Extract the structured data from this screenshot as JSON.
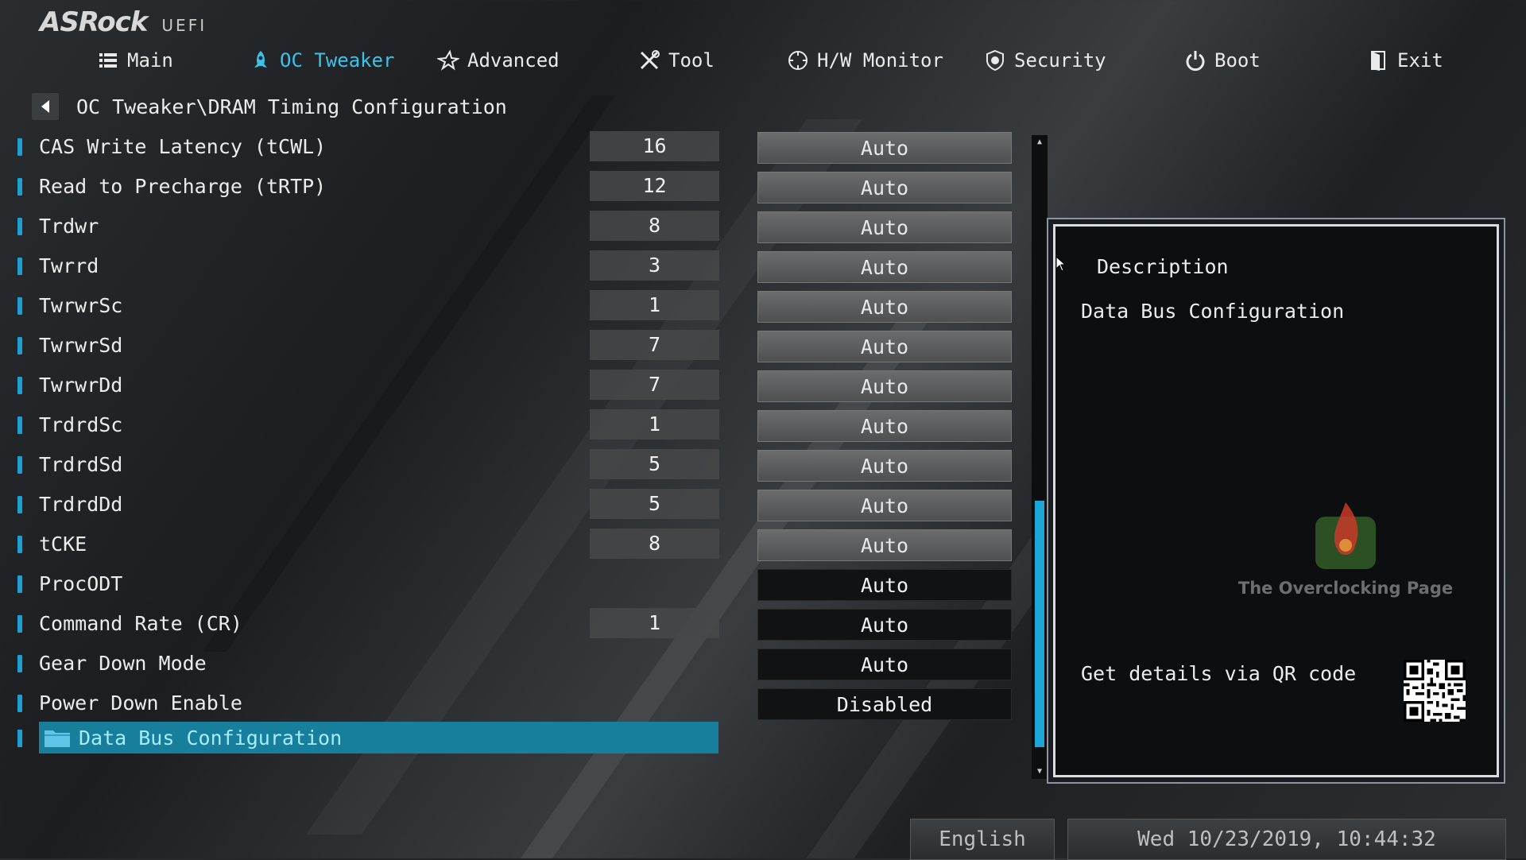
{
  "app": {
    "brand": "ASRock",
    "subtitle": "UEFI"
  },
  "tabs": [
    {
      "label": "Main",
      "icon": "list-icon"
    },
    {
      "label": "OC Tweaker",
      "icon": "rocket-icon",
      "active": true
    },
    {
      "label": "Advanced",
      "icon": "star-icon"
    },
    {
      "label": "Tool",
      "icon": "tools-icon"
    },
    {
      "label": "H/W Monitor",
      "icon": "monitor-icon"
    },
    {
      "label": "Security",
      "icon": "shield-icon"
    },
    {
      "label": "Boot",
      "icon": "power-icon"
    },
    {
      "label": "Exit",
      "icon": "exit-door-icon"
    }
  ],
  "breadcrumb": {
    "path": "OC Tweaker\\DRAM Timing Configuration"
  },
  "settings": [
    {
      "label": "CAS Write Latency (tCWL)",
      "value": "16",
      "option": "Auto",
      "style": "light"
    },
    {
      "label": "Read to Precharge (tRTP)",
      "value": "12",
      "option": "Auto",
      "style": "light"
    },
    {
      "label": "Trdwr",
      "value": "8",
      "option": "Auto",
      "style": "light"
    },
    {
      "label": "Twrrd",
      "value": "3",
      "option": "Auto",
      "style": "light"
    },
    {
      "label": "TwrwrSc",
      "value": "1",
      "option": "Auto",
      "style": "light"
    },
    {
      "label": "TwrwrSd",
      "value": "7",
      "option": "Auto",
      "style": "light"
    },
    {
      "label": "TwrwrDd",
      "value": "7",
      "option": "Auto",
      "style": "light"
    },
    {
      "label": "TrdrdSc",
      "value": "1",
      "option": "Auto",
      "style": "light"
    },
    {
      "label": "TrdrdSd",
      "value": "5",
      "option": "Auto",
      "style": "light"
    },
    {
      "label": "TrdrdDd",
      "value": "5",
      "option": "Auto",
      "style": "light"
    },
    {
      "label": "tCKE",
      "value": "8",
      "option": "Auto",
      "style": "light"
    },
    {
      "label": "ProcODT",
      "value": "",
      "option": "Auto",
      "style": "dark"
    },
    {
      "label": "Command Rate (CR)",
      "value": "1",
      "option": "Auto",
      "style": "dark"
    },
    {
      "label": "Gear Down Mode",
      "value": "",
      "option": "Auto",
      "style": "dark"
    },
    {
      "label": "Power Down Enable",
      "value": "",
      "option": "Disabled",
      "style": "dark"
    }
  ],
  "submenu": {
    "label": "Data Bus Configuration",
    "icon": "folder-icon"
  },
  "description": {
    "title": "Description",
    "text": "Data Bus Configuration",
    "watermark": "The Overclocking Page",
    "qr_text": "Get details via QR code"
  },
  "footer": {
    "language": "English",
    "datetime": "Wed 10/23/2019, 10:44:32"
  },
  "colors": {
    "accent": "#3cc3ea",
    "selection": "#177e9b",
    "scroll_thumb": "#1ba6d8"
  }
}
